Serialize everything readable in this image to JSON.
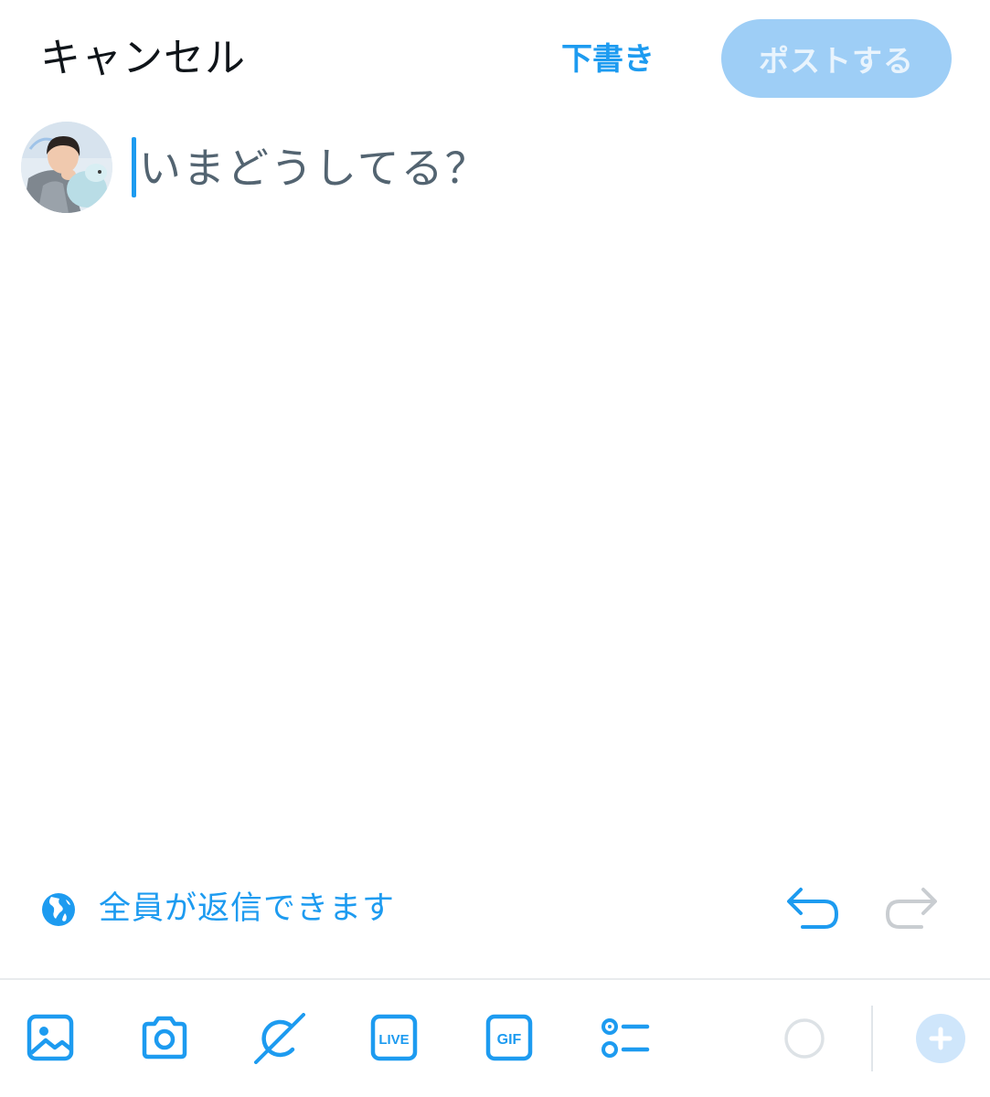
{
  "header": {
    "cancel_label": "キャンセル",
    "drafts_label": "下書き",
    "post_label": "ポストする"
  },
  "composer": {
    "placeholder": "いまどうしてる？"
  },
  "reply_settings": {
    "label": "全員が返信できます",
    "icon": "globe-icon"
  },
  "history": {
    "undo_icon": "undo-icon",
    "redo_icon": "redo-icon"
  },
  "toolbar": {
    "icons": [
      "image-icon",
      "camera-icon",
      "grok-icon",
      "live-icon",
      "gif-icon",
      "poll-icon",
      "character-counter",
      "add-thread-icon"
    ],
    "live_label": "LIVE",
    "gif_label": "GIF"
  },
  "colors": {
    "accent": "#1d9bf0",
    "post_button_disabled": "#9ecef6",
    "placeholder": "#536471",
    "text": "#0f1419"
  }
}
